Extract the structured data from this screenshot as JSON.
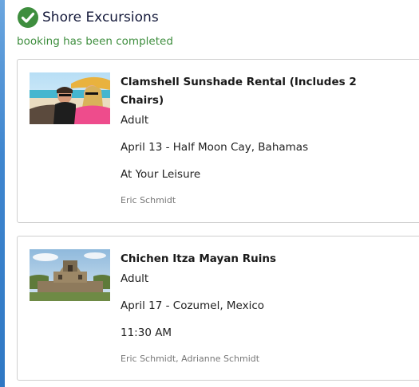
{
  "header": {
    "title": "Shore Excursions",
    "status": "booking has been completed",
    "status_icon": "check-circle-icon",
    "status_color": "#3e8e3e"
  },
  "excursions": [
    {
      "name": "Clamshell Sunshade Rental (Includes 2 Chairs)",
      "passenger_type": "Adult",
      "date_port": "April 13 - Half Moon Cay, Bahamas",
      "time": "At Your Leisure",
      "guests": "Eric Schmidt",
      "image": "beach-couple-photo"
    },
    {
      "name": "Chichen Itza Mayan Ruins",
      "passenger_type": "Adult",
      "date_port": "April 17 - Cozumel, Mexico",
      "time": "11:30 AM",
      "guests": "Eric Schmidt, Adrianne Schmidt",
      "image": "mayan-ruins-photo"
    }
  ]
}
